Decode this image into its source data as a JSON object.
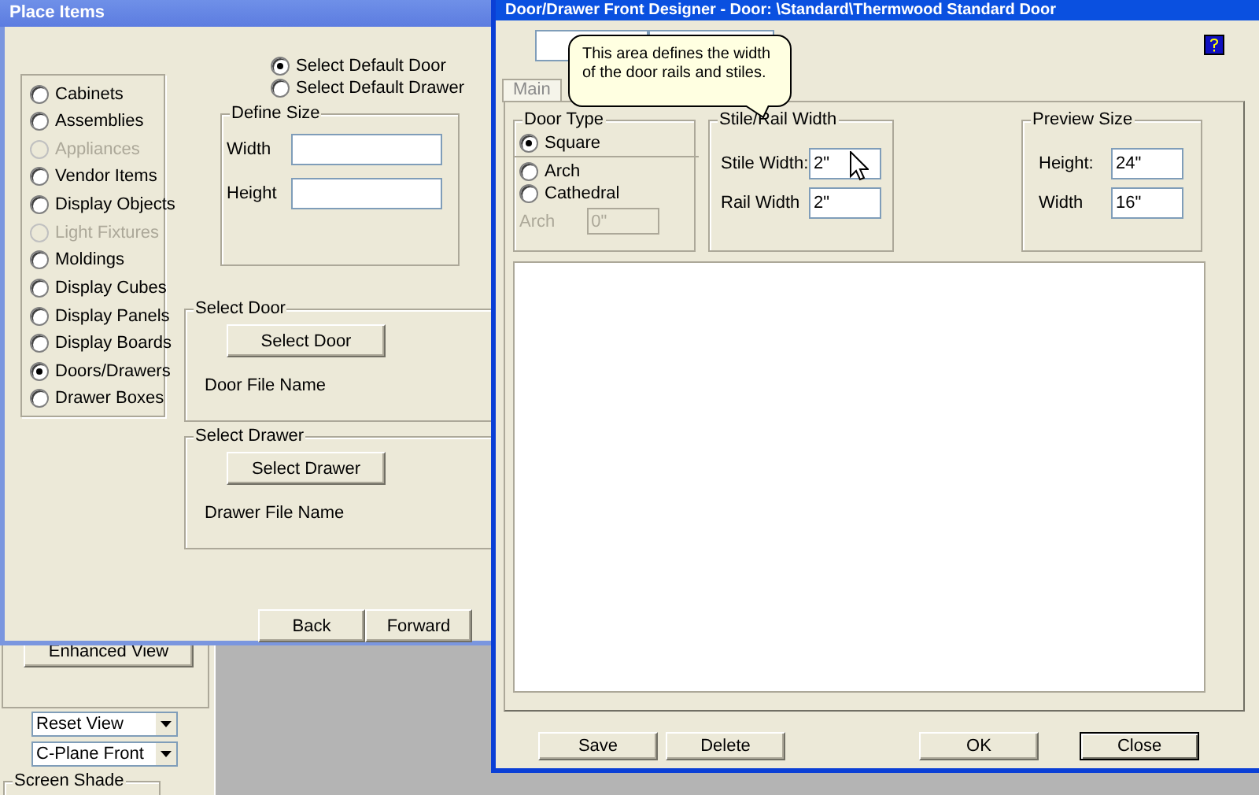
{
  "background_panel": {
    "button": "Enhanced View",
    "dropdowns": [
      "Reset View",
      "C-Plane Front"
    ],
    "group_title": "Screen Shade"
  },
  "place_items": {
    "title": "Place Items",
    "categories": [
      {
        "label": "Cabinets",
        "selected": false,
        "disabled": false
      },
      {
        "label": "Assemblies",
        "selected": false,
        "disabled": false
      },
      {
        "label": "Appliances",
        "selected": false,
        "disabled": true
      },
      {
        "label": "Vendor Items",
        "selected": false,
        "disabled": false
      },
      {
        "label": "Display Objects",
        "selected": false,
        "disabled": false
      },
      {
        "label": "Light Fixtures",
        "selected": false,
        "disabled": true
      },
      {
        "label": "Moldings",
        "selected": false,
        "disabled": false
      },
      {
        "label": "Display Cubes",
        "selected": false,
        "disabled": false
      },
      {
        "label": "Display Panels",
        "selected": false,
        "disabled": false
      },
      {
        "label": "Display Boards",
        "selected": false,
        "disabled": false
      },
      {
        "label": "Doors/Drawers",
        "selected": true,
        "disabled": false
      },
      {
        "label": "Drawer Boxes",
        "selected": false,
        "disabled": false
      }
    ],
    "default_options": [
      {
        "label": "Select Default Door",
        "selected": true
      },
      {
        "label": "Select Default Drawer",
        "selected": false
      }
    ],
    "define_size": {
      "title": "Define Size",
      "fields": [
        {
          "label": "Width"
        },
        {
          "label": "Height"
        }
      ]
    },
    "select_door": {
      "title": "Select Door",
      "button": "Select Door",
      "file_label": "Door File Name"
    },
    "select_drawer": {
      "title": "Select Drawer",
      "button": "Select Drawer",
      "file_label": "Drawer File Name"
    },
    "buttons": [
      "Back",
      "Forward"
    ]
  },
  "designer": {
    "title": "Door/Drawer Front Designer - Door: \\Standard\\Thermwood Standard Door",
    "tabs": [
      {
        "label": "Main",
        "selected": false
      }
    ],
    "door_type": {
      "title": "Door Type",
      "options": [
        {
          "label": "Square",
          "selected": true
        },
        {
          "label": "Arch",
          "selected": false
        },
        {
          "label": "Cathedral",
          "selected": false
        }
      ],
      "arch_field": {
        "label": "Arch",
        "value": "0\"",
        "disabled": true
      }
    },
    "stile_rail": {
      "title": "Stile/Rail Width",
      "fields": [
        {
          "label": "Stile Width:",
          "value": "2\""
        },
        {
          "label": "Rail Width",
          "value": "2\""
        }
      ]
    },
    "preview_size": {
      "title": "Preview Size",
      "fields": [
        {
          "label": "Height:",
          "value": "24\""
        },
        {
          "label": "Width",
          "value": "16\""
        }
      ]
    },
    "buttons": [
      {
        "label": "Save",
        "default": false
      },
      {
        "label": "Delete",
        "default": false
      },
      {
        "label": "OK",
        "default": false
      },
      {
        "label": "Close",
        "default": true
      }
    ]
  },
  "tooltip": {
    "text": "This area defines the width of the door rails and stiles."
  }
}
